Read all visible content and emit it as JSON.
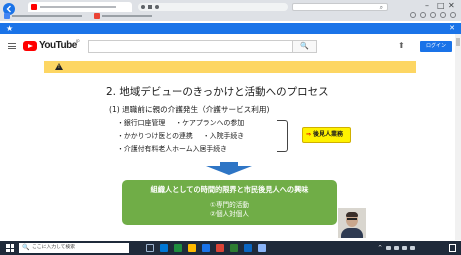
{
  "browser": {
    "tab": {
      "title": ""
    },
    "address_bar": {
      "url": ""
    },
    "search_box": {
      "placeholder": ""
    },
    "window_controls": {
      "minimize": "–",
      "maximize": "□",
      "close": "✕"
    },
    "bookmarks": [
      {
        "label": ""
      },
      {
        "label": ""
      }
    ]
  },
  "promo_bar": {
    "icon": "star-icon",
    "text": "",
    "link": "",
    "close": "✕"
  },
  "youtube": {
    "logo_text": "YouTube",
    "region": "JP",
    "search_placeholder": "",
    "search_icon": "🔍",
    "upload_icon": "⬆",
    "signin_label": "ログイン"
  },
  "warning_banner": {
    "icon": "warning-icon",
    "message": "",
    "link": ""
  },
  "slide": {
    "title": "2. 地域デビューのきっかけと活動へのプロセス",
    "subtitle": "(1) 退職前に親の介護発生（介護サービス利用)",
    "bullets": [
      "・銀行口座管理",
      "・ケアプランへの参加",
      "・かかりつけ医との連携",
      "・入院手続き",
      "・介護付有料老人ホーム入居手続き"
    ],
    "role_box": {
      "arrow": "⇒",
      "label": "後見人業務"
    },
    "green_box": {
      "title": "組織人としての時間的限界と市民後見人への興味",
      "items": [
        "①専門的活動",
        "②個人対個人"
      ]
    }
  },
  "taskbar": {
    "search_placeholder": "ここに入力して検索",
    "search_icon": "🔍",
    "time": "",
    "date": ""
  },
  "colors": {
    "chrome_blue": "#1a73e8",
    "youtube_red": "#ff0000",
    "warning_yellow": "#fdd663",
    "slide_arrow_blue": "#2e75c5",
    "slide_green": "#70ad47",
    "role_yellow": "#fff200",
    "taskbar": "#1f2a3a"
  }
}
